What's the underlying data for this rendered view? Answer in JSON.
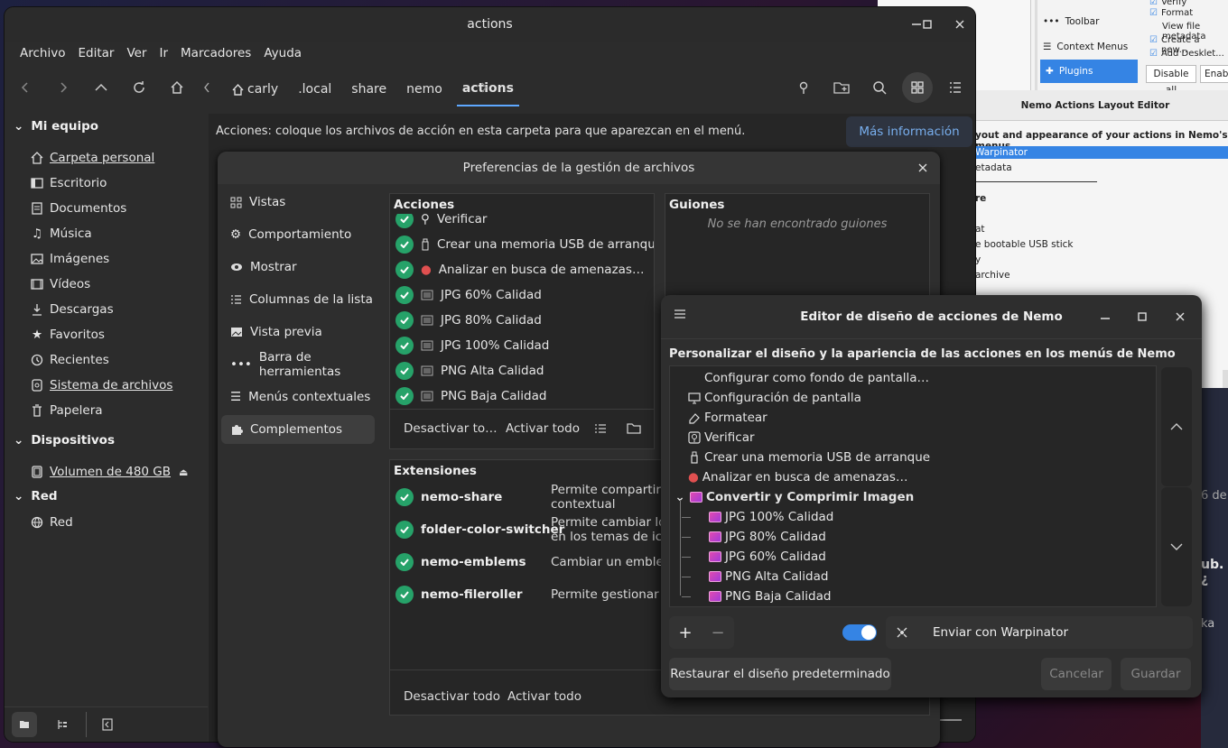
{
  "bg_window": {
    "items": [
      "Toolbar",
      "Context Menus",
      "Plugins"
    ],
    "checks": [
      "Verify",
      "Format",
      "View file metadata",
      "Create a new...",
      "Add Desklet..."
    ],
    "buttons": [
      "Disable all",
      "Enab"
    ]
  },
  "bg_editor": {
    "title": "Nemo Actions Layout Editor",
    "subtitle": "yout and appearance of your actions in Nemo's menus",
    "rows": [
      "Warpinator",
      "etadata",
      "re",
      "at",
      "e bootable USB stick",
      "y",
      "archive"
    ]
  },
  "nemo": {
    "title": "actions",
    "menu": [
      "Archivo",
      "Editar",
      "Ver",
      "Ir",
      "Marcadores",
      "Ayuda"
    ],
    "breadcrumbs": [
      "carly",
      ".local",
      "share",
      "nemo",
      "actions"
    ],
    "info_text": "Acciones: coloque los archivos de acción en esta carpeta para que aparezcan en el menú.",
    "info_button": "Más información",
    "sidebar": {
      "sections": [
        {
          "title": "Mi equipo",
          "items": [
            {
              "label": "Carpeta personal",
              "icon": "home-icon"
            },
            {
              "label": "Escritorio",
              "icon": "desktop-icon"
            },
            {
              "label": "Documentos",
              "icon": "document-icon"
            },
            {
              "label": "Música",
              "icon": "music-icon"
            },
            {
              "label": "Imágenes",
              "icon": "image-icon"
            },
            {
              "label": "Vídeos",
              "icon": "video-icon"
            },
            {
              "label": "Descargas",
              "icon": "download-icon"
            },
            {
              "label": "Favoritos",
              "icon": "star-icon"
            },
            {
              "label": "Recientes",
              "icon": "recent-icon"
            },
            {
              "label": "Sistema de archivos",
              "icon": "drive-icon"
            },
            {
              "label": "Papelera",
              "icon": "trash-icon"
            }
          ]
        },
        {
          "title": "Dispositivos",
          "items": [
            {
              "label": "Volumen de 480 GB",
              "icon": "disk-icon"
            }
          ]
        },
        {
          "title": "Red",
          "items": [
            {
              "label": "Red",
              "icon": "network-icon"
            }
          ]
        }
      ]
    }
  },
  "prefs": {
    "title": "Preferencias de la gestión de archivos",
    "nav": [
      "Vistas",
      "Comportamiento",
      "Mostrar",
      "Columnas de la lista",
      "Vista previa",
      "Barra de herramientas",
      "Menús contextuales",
      "Complementos"
    ],
    "actions_title": "Acciones",
    "actions": [
      "Verificar",
      "Crear una memoria USB de arranque",
      "Analizar en busca de amenazas…",
      "JPG 60% Calidad",
      "JPG 80% Calidad",
      "JPG 100% Calidad",
      "PNG Alta Calidad",
      "PNG Baja Calidad"
    ],
    "actions_disable": "Desactivar to…",
    "actions_enable": "Activar todo",
    "scripts_title": "Guiones",
    "scripts_empty": "No se han encontrado guiones",
    "ext_title": "Extensiones",
    "extensions": [
      {
        "name": "nemo-share",
        "desc": "Permite compartir ráp\ncontextual"
      },
      {
        "name": "folder-color-switcher",
        "desc": "Permite cambiar los c\nen los temas de icono"
      },
      {
        "name": "nemo-emblems",
        "desc": "Cambiar un emblema"
      },
      {
        "name": "nemo-fileroller",
        "desc": "Permite gestionar arc"
      }
    ],
    "ext_disable": "Desactivar todo",
    "ext_enable": "Activar todo"
  },
  "editor": {
    "title": "Editor de diseño de acciones de Nemo",
    "subtitle": "Personalizar el diseño y la apariencia de las acciones en los menús de Nemo",
    "tree": [
      {
        "label": "Configurar como fondo de pantalla…",
        "icon": "none"
      },
      {
        "label": "Configuración de pantalla",
        "icon": "monitor-icon"
      },
      {
        "label": "Formatear",
        "icon": "eraser-icon"
      },
      {
        "label": "Verificar",
        "icon": "verify-icon"
      },
      {
        "label": "Crear una memoria USB de arranque",
        "icon": "usb-icon"
      },
      {
        "label": "Analizar en busca de amenazas…",
        "icon": "clam-icon"
      },
      {
        "label": "Convertir y Comprimir Imagen",
        "icon": "image-icon"
      }
    ],
    "tree_children": [
      "JPG 100% Calidad",
      "JPG 80% Calidad",
      "JPG 60% Calidad",
      "PNG Alta Calidad",
      "PNG Baja Calidad"
    ],
    "selected_name": "Enviar con Warpinator",
    "restore": "Restaurar el diseño predeterminado",
    "cancel": "Cancelar",
    "save": "Guardar"
  },
  "colors": {
    "accent": "#3584e4",
    "check": "#26a269",
    "link": "#78aeed"
  }
}
